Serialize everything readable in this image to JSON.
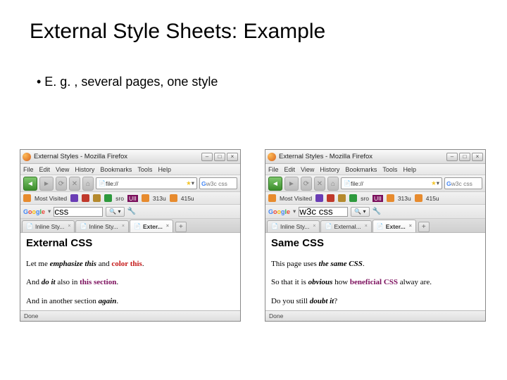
{
  "title": "External Style Sheets: Example",
  "bullet": "•   E. g. , several pages, one style",
  "browsers": [
    {
      "title": "External Styles - Mozilla Firefox",
      "menus": [
        "File",
        "Edit",
        "View",
        "History",
        "Bookmarks",
        "Tools",
        "Help"
      ],
      "address": "file://",
      "search": "w3c css",
      "bookmark_label": "Most Visited",
      "bookmark_items": [
        "313u",
        "415u"
      ],
      "google_search": "css",
      "tabs": [
        {
          "label": "Inline Sty...",
          "active": false
        },
        {
          "label": "Inline Sty...",
          "active": false
        },
        {
          "label": "Exter...",
          "active": true
        }
      ],
      "heading": "External CSS",
      "paragraphs": [
        {
          "p": "Let me ",
          "em": "emphasize this",
          "mid": " and ",
          "color": "color this",
          "colorcls": "clr-red",
          "tail": "."
        },
        {
          "p": "And ",
          "em": "do it",
          "mid": " also in ",
          "color": "this section",
          "colorcls": "clr-maroon",
          "tail": "."
        },
        {
          "p": "And in another section ",
          "em": "again",
          "mid": "",
          "color": "",
          "colorcls": "",
          "tail": "."
        }
      ],
      "status": "Done"
    },
    {
      "title": "External Styles - Mozilla Firefox",
      "menus": [
        "File",
        "Edit",
        "View",
        "History",
        "Bookmarks",
        "Tools",
        "Help"
      ],
      "address": "file://",
      "search": "w3c css",
      "bookmark_label": "Most Visited",
      "bookmark_items": [
        "313u",
        "415u"
      ],
      "google_search": "w3c css",
      "tabs": [
        {
          "label": "Inline Sty...",
          "active": false
        },
        {
          "label": "External...",
          "active": false
        },
        {
          "label": "Exter...",
          "active": true
        }
      ],
      "heading": "Same CSS",
      "paragraphs": [
        {
          "p": "This page uses ",
          "em": "the same CSS",
          "mid": "",
          "color": "",
          "colorcls": "",
          "tail": "."
        },
        {
          "p": "So that it is ",
          "em": "obvious",
          "mid": " how ",
          "color": "beneficial CSS",
          "colorcls": "clr-maroon",
          "tail": " alway are."
        },
        {
          "p": "Do you still ",
          "em": "doubt it",
          "mid": "",
          "color": "",
          "colorcls": "clr-blue",
          "tail": "?"
        }
      ],
      "status": "Done"
    }
  ],
  "winbtns": [
    "–",
    "□",
    "×"
  ]
}
